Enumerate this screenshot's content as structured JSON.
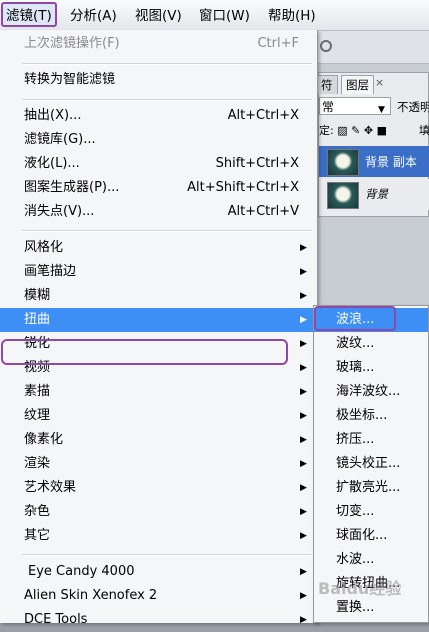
{
  "menubar": {
    "items": [
      "滤镜(T)",
      "分析(A)",
      "视图(V)",
      "窗口(W)",
      "帮助(H)"
    ]
  },
  "filter_menu": {
    "last_filter": {
      "label": "上次滤镜操作(F)",
      "shortcut": "Ctrl+F"
    },
    "smart_filter": "转换为智能滤镜",
    "group2": [
      {
        "label": "抽出(X)...",
        "shortcut": "Alt+Ctrl+X"
      },
      {
        "label": "滤镜库(G)...",
        "shortcut": ""
      },
      {
        "label": "液化(L)...",
        "shortcut": "Shift+Ctrl+X"
      },
      {
        "label": "图案生成器(P)...",
        "shortcut": "Alt+Shift+Ctrl+X"
      },
      {
        "label": "消失点(V)...",
        "shortcut": "Alt+Ctrl+V"
      }
    ],
    "group3": [
      "风格化",
      "画笔描边",
      "模糊",
      "扭曲",
      "锐化",
      "视频",
      "素描",
      "纹理",
      "像素化",
      "渲染",
      "艺术效果",
      "杂色",
      "其它"
    ],
    "group4": [
      "Eye Candy 4000",
      "Alien Skin Xenofex 2",
      "DCE Tools"
    ]
  },
  "distort_submenu": [
    "波浪...",
    "波纹...",
    "玻璃...",
    "海洋波纹...",
    "极坐标...",
    "挤压...",
    "镜头校正...",
    "扩散亮光...",
    "切变...",
    "球面化...",
    "水波...",
    "旋转扭曲...",
    "置换..."
  ],
  "layers_panel": {
    "tab_chars": "符",
    "tab_layers": "图层",
    "tab_close": "×",
    "blend_mode": "常",
    "opacity_label": "不透明",
    "lock_label": "定:",
    "fill_label": "填",
    "layers": [
      "背景 副本",
      "背景"
    ]
  },
  "watermark": "Baidu经验",
  "colors": {
    "highlight_blue": "#3d8ef5",
    "annotation_purple": "#8e48a8",
    "selected_layer": "#3b6fc7"
  }
}
